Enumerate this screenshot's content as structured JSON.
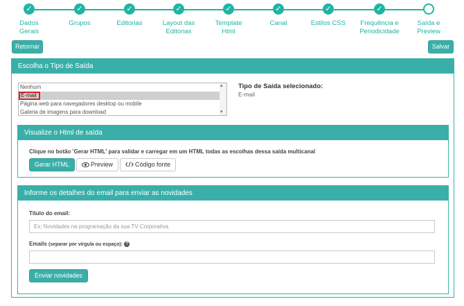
{
  "wizard": {
    "steps": [
      {
        "label": "Dados\nGerais",
        "state": "done"
      },
      {
        "label": "Grupos",
        "state": "done"
      },
      {
        "label": "Editorias",
        "state": "done"
      },
      {
        "label": "Layout das\nEditorias",
        "state": "done"
      },
      {
        "label": "Template\nHtml",
        "state": "done"
      },
      {
        "label": "Canal",
        "state": "done"
      },
      {
        "label": "Estilos CSS",
        "state": "done"
      },
      {
        "label": "Frequência e\nPeriodicidade",
        "state": "done"
      },
      {
        "label": "Saída e\nPreview",
        "state": "current"
      }
    ],
    "check_icon": "check-icon",
    "accent_color": "#1fb5a3"
  },
  "actions": {
    "retornar": "Retornar",
    "salvar": "Salvar"
  },
  "tipo_saida": {
    "heading": "Escolha o Tipo de Saída",
    "options": [
      "Nenhum",
      "E-mail",
      "Página web para navegadores desktop ou mobile",
      "Galeria de imagens para download"
    ],
    "selected_index": 1,
    "selected_title": "Tipo de Saída selecionado:",
    "selected_value": "E-mail"
  },
  "html_saida": {
    "heading": "Visualize o Html de saída",
    "instruction": "Clique no botão 'Gerar HTML' para validar e carregar em um HTML todas as escolhas dessa saída multicanal",
    "gerar_label": "Gerar HTML",
    "preview_label": "Preview",
    "codigo_label": "Código fonte",
    "preview_icon": "eye-icon",
    "codigo_icon": "code-icon"
  },
  "email": {
    "heading": "Informe os detalhes do email para enviar as novidades",
    "titulo_label": "Título do email:",
    "titulo_placeholder": "Ex: Novidades na programação da sua TV Corporativa",
    "emails_label": "Emails",
    "emails_hint": "(separar por vírgula ou espaço):",
    "emails_value": "",
    "enviar_label": "Enviar novidades",
    "help_icon": "question-circle-icon"
  }
}
